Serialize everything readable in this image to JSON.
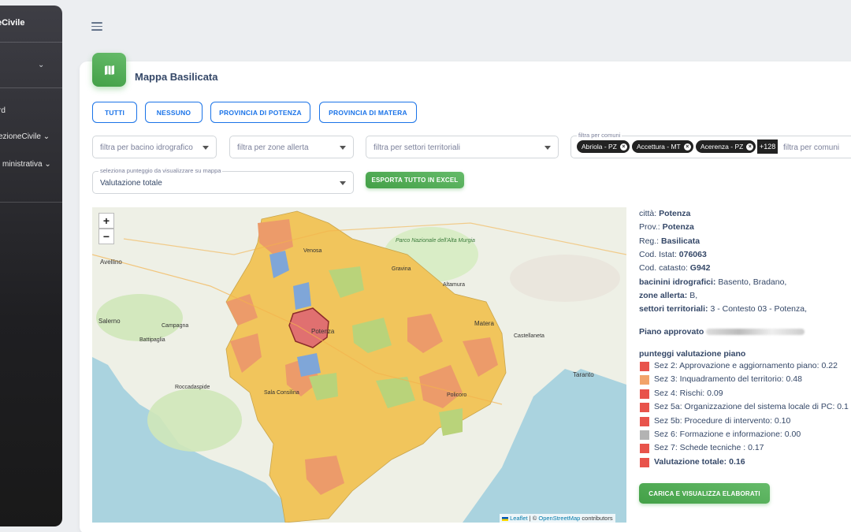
{
  "sidebar": {
    "brand": "eCivile",
    "items": [
      {
        "label": "rd"
      },
      {
        "label": "ezioneCivile"
      },
      {
        "label": "ministrativa"
      }
    ]
  },
  "card": {
    "title": "Mappa Basilicata",
    "icon": "map-icon"
  },
  "filter_buttons": [
    "TUTTI",
    "NESSUNO",
    "PROVINCIA DI POTENZA",
    "PROVINCIA DI MATERA"
  ],
  "filters": {
    "bacino_placeholder": "filtra per bacino idrografico",
    "zone_placeholder": "filtra per zone allerta",
    "settori_placeholder": "filtra per settori territoriali",
    "comuni_label": "filtra per comuni",
    "comuni_placeholder": "filtra per comuni",
    "comuni_chips": [
      "Abriola - PZ",
      "Accettura - MT",
      "Acerenza - PZ"
    ],
    "comuni_more": "+128"
  },
  "punteggio": {
    "label": "seleziona punteggio da visualizzare su mappa",
    "value": "Valutazione totale"
  },
  "export_button": "ESPORTA TUTTO IN EXCEL",
  "map": {
    "zoom_in": "+",
    "zoom_out": "−",
    "attribution_leaflet": "Leaflet",
    "attribution_sep": " | © ",
    "attribution_osm": "OpenStreetMap",
    "attribution_rest": " contributors",
    "labels": [
      "Potenza",
      "Matera",
      "Avellino",
      "Salerno",
      "Taranto",
      "Battipaglia",
      "Campagna",
      "Roccadaspide",
      "Sala Consilina",
      "Altamura",
      "Gravina",
      "Castellaneta",
      "Policoro",
      "Venosa",
      "Parco Nazionale dell'Alta Murgia"
    ]
  },
  "info": {
    "citta_label": "città: ",
    "citta": "Potenza",
    "prov_label": "Prov.: ",
    "prov": "Potenza",
    "reg_label": "Reg.: ",
    "reg": "Basilicata",
    "istat_label": "Cod. Istat: ",
    "istat": "076063",
    "catasto_label": "Cod. catasto: ",
    "catasto": "G942",
    "bacini_label": "bacinini idrografici: ",
    "bacini": "Basento, Bradano,",
    "zone_label": "zone allerta: ",
    "zone": "B,",
    "settori_label": "settori territoriali: ",
    "settori": "3 - Contesto 03 - Potenza,",
    "piano_label": "Piano approvato",
    "punteggi_title": "punteggi valutazione piano",
    "scores": [
      {
        "label": "Sez 2: Approvazione e aggiornamento piano: 0.22",
        "color": "#e8534b",
        "bold": false
      },
      {
        "label": "Sez 3: Inquadramento del territorio: 0.48",
        "color": "#f2a36a",
        "bold": false
      },
      {
        "label": "Sez 4: Rischi: 0.09",
        "color": "#e8534b",
        "bold": false
      },
      {
        "label": "Sez 5a: Organizzazione del sistema locale di PC: 0.1",
        "color": "#e8534b",
        "bold": false
      },
      {
        "label": "Sez 5b: Procedure di intervento: 0.10",
        "color": "#e8534b",
        "bold": false
      },
      {
        "label": "Sez 6: Formazione e informazione: 0.00",
        "color": "#b3b3b3",
        "bold": false
      },
      {
        "label": "Sez 7: Schede tecniche : 0.17",
        "color": "#e8534b",
        "bold": false
      },
      {
        "label": "Valutazione totale: 0.16",
        "color": "#e8534b",
        "bold": true
      }
    ]
  },
  "load_button": "CARICA E VISUALIZZA ELABORATI"
}
